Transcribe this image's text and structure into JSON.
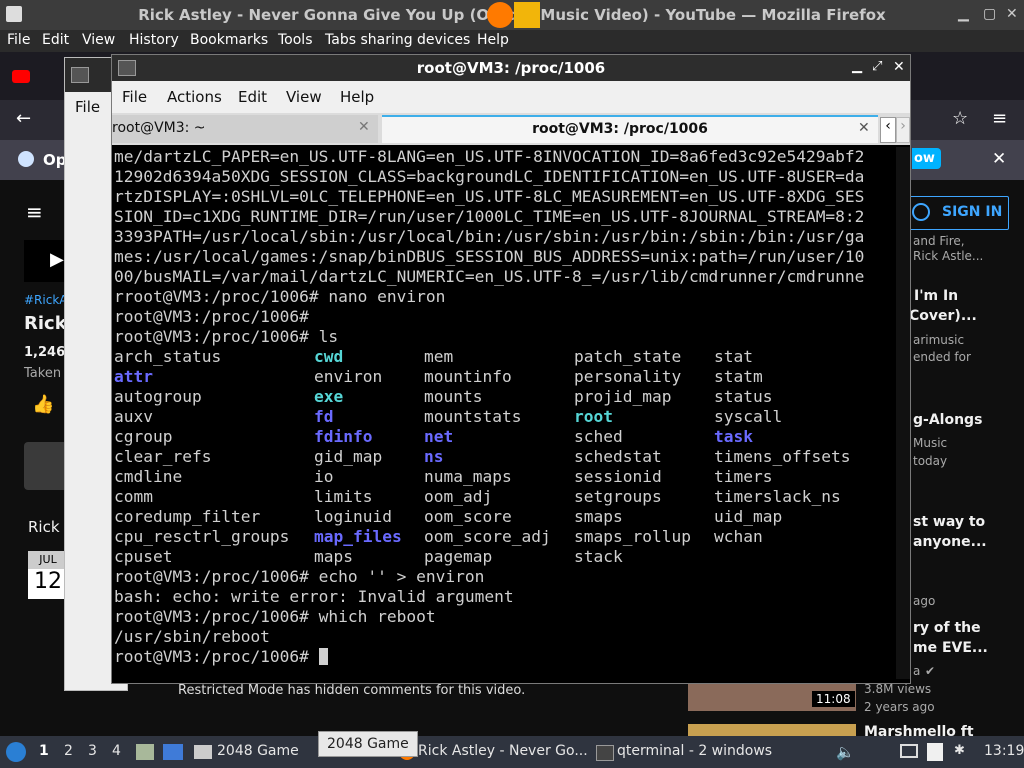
{
  "firefox": {
    "title": "Rick Astley - Never Gonna Give You Up (Official Music Video) - YouTube — Mozilla Firefox",
    "menu": [
      "File",
      "Edit",
      "View",
      "History",
      "Bookmarks",
      "Tools",
      "Tabs sharing devices",
      "Help"
    ],
    "notif_prefix": "Op",
    "notif_button": "ow",
    "sign_in": "SIGN IN",
    "youtube_left": {
      "tag": "#RickA",
      "title_prefix": "Rick",
      "views_prefix": "1,246,",
      "taken": "Taken",
      "channel_prefix": "Rick",
      "date_month": "JUL",
      "date_day": "12",
      "restricted": "Restricted Mode has hidden comments for this video."
    },
    "youtube_right": [
      {
        "l1": "and Fire,",
        "l2": "Rick Astle..."
      },
      {
        "l1": "I'm In",
        "l2": "Cover)...",
        "l3": "arimusic",
        "l4": "ended for"
      },
      {
        "l1": "g-Alongs",
        "l2": "Music",
        "l3": "today"
      },
      {
        "l1": "st way to",
        "l2": "anyone..."
      },
      {
        "l1": "ago"
      },
      {
        "l1": "ry of the",
        "l2": "me EVE...",
        "l3": "a"
      },
      {
        "duration": "11:08",
        "l1": "3.8M views",
        "l2": "2 years ago"
      },
      {
        "l1": "Marshmello ft"
      }
    ]
  },
  "terminal": {
    "title": "root@VM3: /proc/1006",
    "menu": [
      "File",
      "Actions",
      "Edit",
      "View",
      "Help"
    ],
    "tabs": [
      "root@VM3: ~",
      "root@VM3: /proc/1006"
    ],
    "back_window_menu": "File",
    "env_lines": [
      "me/dartzLC_PAPER=en_US.UTF-8LANG=en_US.UTF-8INVOCATION_ID=8a6fed3c92e5429abf2",
      "12902d6394a50XDG_SESSION_CLASS=backgroundLC_IDENTIFICATION=en_US.UTF-8USER=da",
      "rtzDISPLAY=:0SHLVL=0LC_TELEPHONE=en_US.UTF-8LC_MEASUREMENT=en_US.UTF-8XDG_SES",
      "SION_ID=c1XDG_RUNTIME_DIR=/run/user/1000LC_TIME=en_US.UTF-8JOURNAL_STREAM=8:2",
      "3393PATH=/usr/local/sbin:/usr/local/bin:/usr/sbin:/usr/bin:/sbin:/bin:/usr/ga",
      "mes:/usr/local/games:/snap/binDBUS_SESSION_BUS_ADDRESS=unix:path=/run/user/10",
      "00/busMAIL=/var/mail/dartzLC_NUMERIC=en_US.UTF-8_=/usr/lib/cmdrunner/cmdrunne",
      "rroot@VM3:/proc/1006# nano environ",
      "root@VM3:/proc/1006#",
      "root@VM3:/proc/1006# ls"
    ],
    "ls_rows": [
      [
        [
          "arch_status",
          ""
        ],
        [
          "cwd",
          "cyan"
        ],
        [
          "mem",
          ""
        ],
        [
          "patch_state",
          ""
        ],
        [
          "stat",
          ""
        ]
      ],
      [
        [
          "attr",
          "blue"
        ],
        [
          "environ",
          ""
        ],
        [
          "mountinfo",
          ""
        ],
        [
          "personality",
          ""
        ],
        [
          "statm",
          ""
        ]
      ],
      [
        [
          "autogroup",
          ""
        ],
        [
          "exe",
          "cyan"
        ],
        [
          "mounts",
          ""
        ],
        [
          "projid_map",
          ""
        ],
        [
          "status",
          ""
        ]
      ],
      [
        [
          "auxv",
          ""
        ],
        [
          "fd",
          "blue"
        ],
        [
          "mountstats",
          ""
        ],
        [
          "root",
          "cyan"
        ],
        [
          "syscall",
          ""
        ]
      ],
      [
        [
          "cgroup",
          ""
        ],
        [
          "fdinfo",
          "blue"
        ],
        [
          "net",
          "blue"
        ],
        [
          "sched",
          ""
        ],
        [
          "task",
          "blue"
        ]
      ],
      [
        [
          "clear_refs",
          ""
        ],
        [
          "gid_map",
          ""
        ],
        [
          "ns",
          "blue"
        ],
        [
          "schedstat",
          ""
        ],
        [
          "timens_offsets",
          ""
        ]
      ],
      [
        [
          "cmdline",
          ""
        ],
        [
          "io",
          ""
        ],
        [
          "numa_maps",
          ""
        ],
        [
          "sessionid",
          ""
        ],
        [
          "timers",
          ""
        ]
      ],
      [
        [
          "comm",
          ""
        ],
        [
          "limits",
          ""
        ],
        [
          "oom_adj",
          ""
        ],
        [
          "setgroups",
          ""
        ],
        [
          "timerslack_ns",
          ""
        ]
      ],
      [
        [
          "coredump_filter",
          ""
        ],
        [
          "loginuid",
          ""
        ],
        [
          "oom_score",
          ""
        ],
        [
          "smaps",
          ""
        ],
        [
          "uid_map",
          ""
        ]
      ],
      [
        [
          "cpu_resctrl_groups",
          ""
        ],
        [
          "map_files",
          "blue"
        ],
        [
          "oom_score_adj",
          ""
        ],
        [
          "smaps_rollup",
          ""
        ],
        [
          "wchan",
          ""
        ]
      ],
      [
        [
          "cpuset",
          ""
        ],
        [
          "maps",
          ""
        ],
        [
          "pagemap",
          ""
        ],
        [
          "stack",
          ""
        ],
        [
          "",
          ""
        ]
      ]
    ],
    "after_lines": [
      "root@VM3:/proc/1006# echo '' > environ",
      "bash: echo: write error: Invalid argument",
      "root@VM3:/proc/1006# which reboot",
      "/usr/sbin/reboot",
      "root@VM3:/proc/1006# "
    ]
  },
  "taskbar": {
    "workspaces": [
      "1",
      "2",
      "3",
      "4"
    ],
    "items": [
      "2048 Game",
      "Rick Astley - Never Go...",
      "qterminal - 2 windows"
    ],
    "tooltip": "2048 Game",
    "clock": "13:19"
  }
}
